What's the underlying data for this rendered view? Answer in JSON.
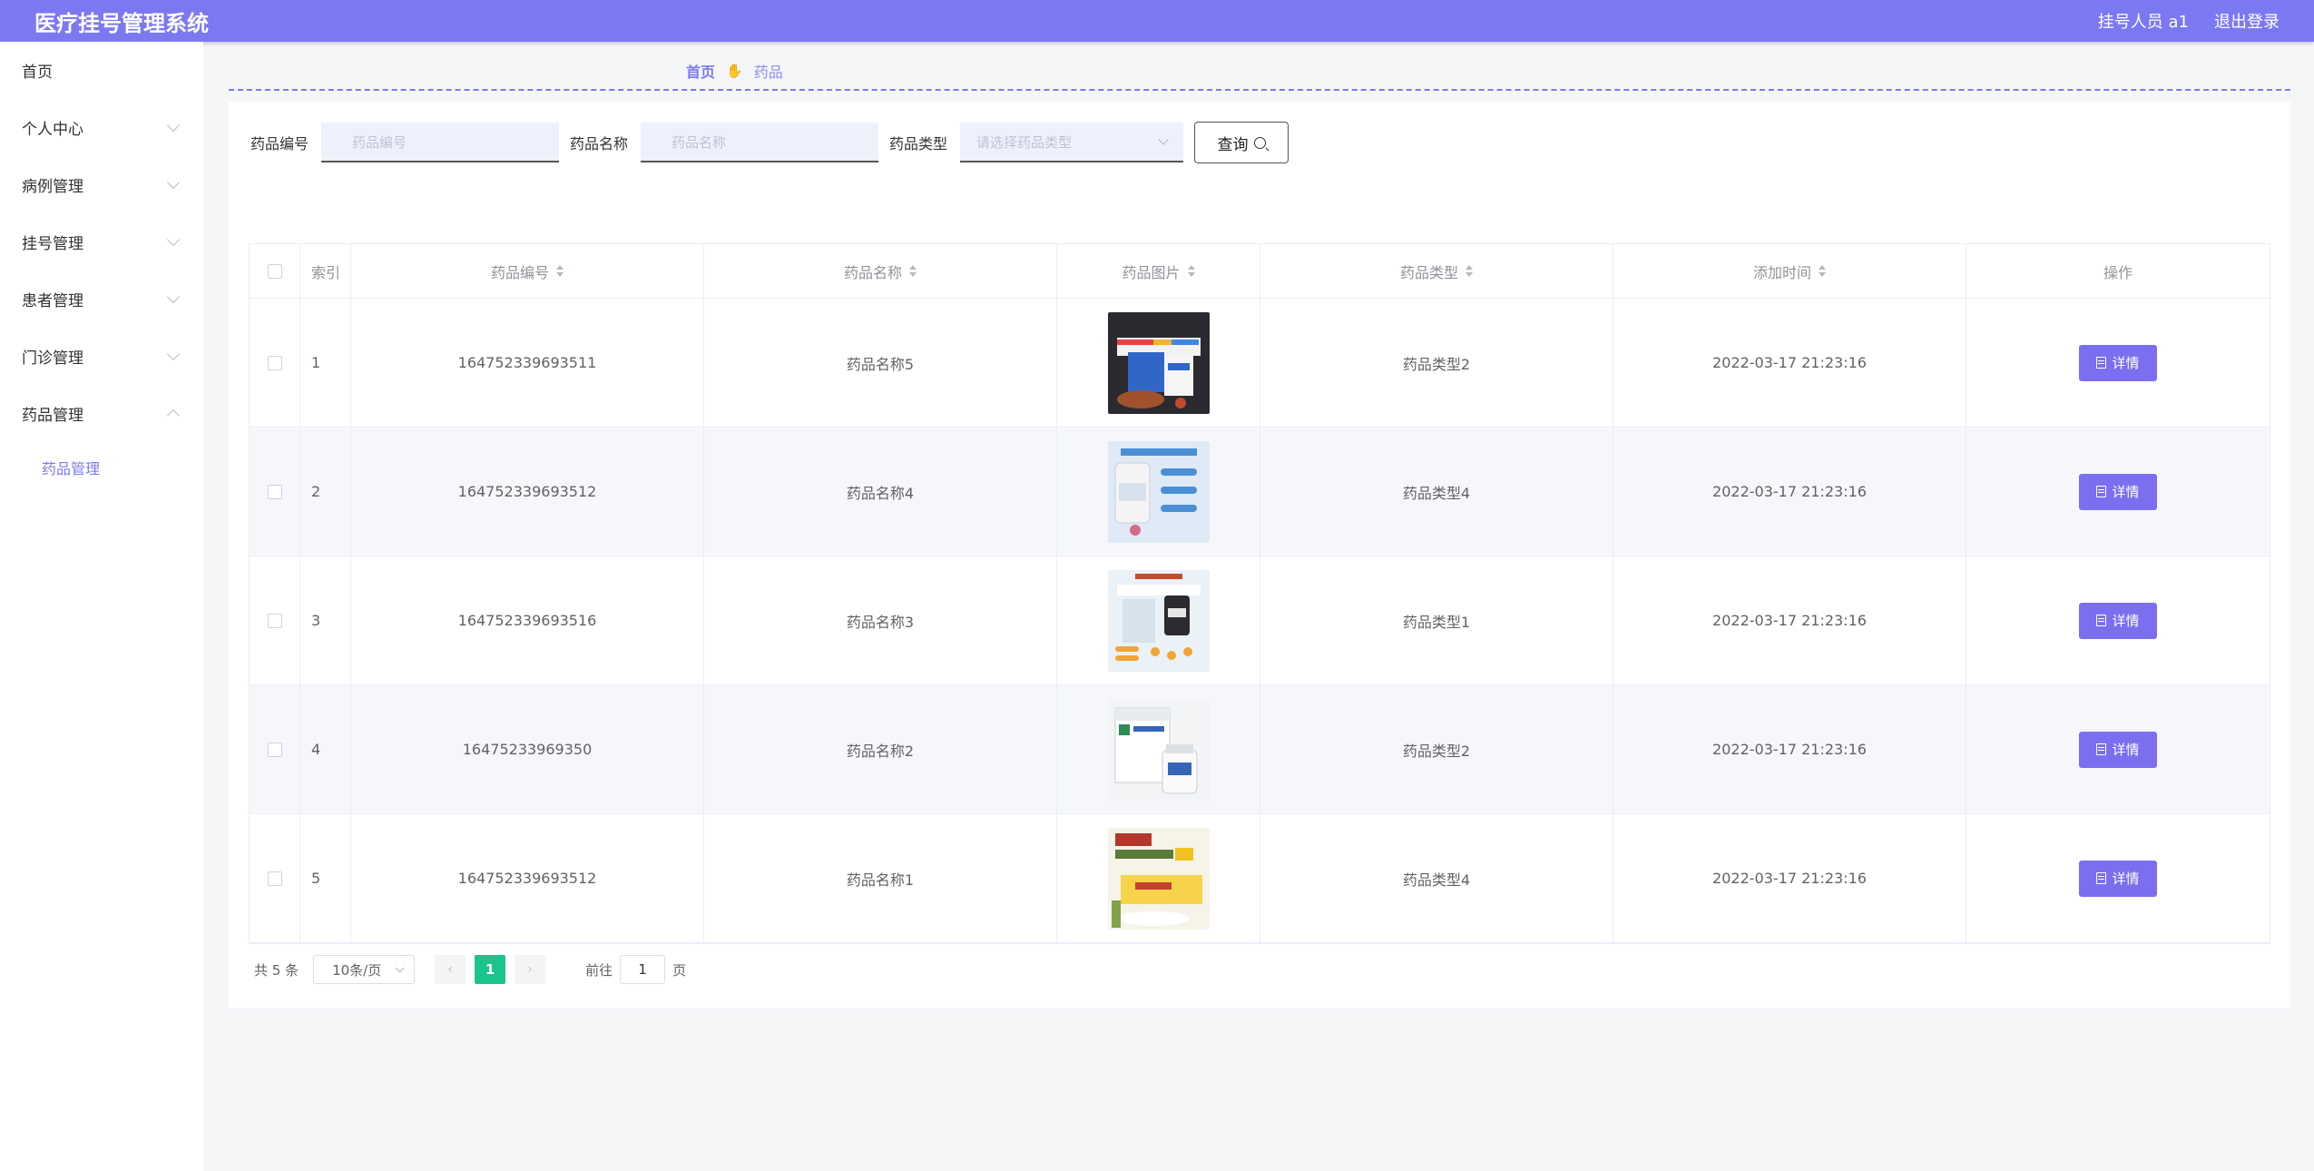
{
  "header": {
    "title": "医疗挂号管理系统",
    "user": "挂号人员 a1",
    "logout": "退出登录",
    "accent": "#7b79f1"
  },
  "sidebar": {
    "items": [
      {
        "label": "首页",
        "expandable": false
      },
      {
        "label": "个人中心",
        "expandable": true
      },
      {
        "label": "病例管理",
        "expandable": true
      },
      {
        "label": "挂号管理",
        "expandable": true
      },
      {
        "label": "患者管理",
        "expandable": true
      },
      {
        "label": "门诊管理",
        "expandable": true
      },
      {
        "label": "药品管理",
        "expandable": true,
        "expanded": true
      }
    ],
    "sub_item": "药品管理"
  },
  "breadcrumb": {
    "home": "首页",
    "separator_icon": "hand-icon",
    "current": "药品"
  },
  "search": {
    "code_label": "药品编号",
    "code_placeholder": "药品编号",
    "name_label": "药品名称",
    "name_placeholder": "药品名称",
    "type_label": "药品类型",
    "type_placeholder": "请选择药品类型",
    "query_button": "查询"
  },
  "table": {
    "columns": {
      "index": "索引",
      "code": "药品编号",
      "name": "药品名称",
      "image": "药品图片",
      "type": "药品类型",
      "time": "添加时间",
      "op": "操作"
    },
    "detail_label": "详情",
    "rows": [
      {
        "index": "1",
        "code": "164752339693511",
        "name": "药品名称5",
        "type": "药品类型2",
        "time": "2022-03-17 21:23:16"
      },
      {
        "index": "2",
        "code": "164752339693512",
        "name": "药品名称4",
        "type": "药品类型4",
        "time": "2022-03-17 21:23:16"
      },
      {
        "index": "3",
        "code": "164752339693516",
        "name": "药品名称3",
        "type": "药品类型1",
        "time": "2022-03-17 21:23:16"
      },
      {
        "index": "4",
        "code": "16475233969350",
        "name": "药品名称2",
        "type": "药品类型2",
        "time": "2022-03-17 21:23:16"
      },
      {
        "index": "5",
        "code": "164752339693512",
        "name": "药品名称1",
        "type": "药品类型4",
        "time": "2022-03-17 21:23:16"
      }
    ]
  },
  "pagination": {
    "total": "共 5 条",
    "page_size": "10条/页",
    "prev": "‹",
    "current": "1",
    "next": "›",
    "goto_prefix": "前往",
    "goto_value": "1",
    "goto_suffix": "页"
  }
}
